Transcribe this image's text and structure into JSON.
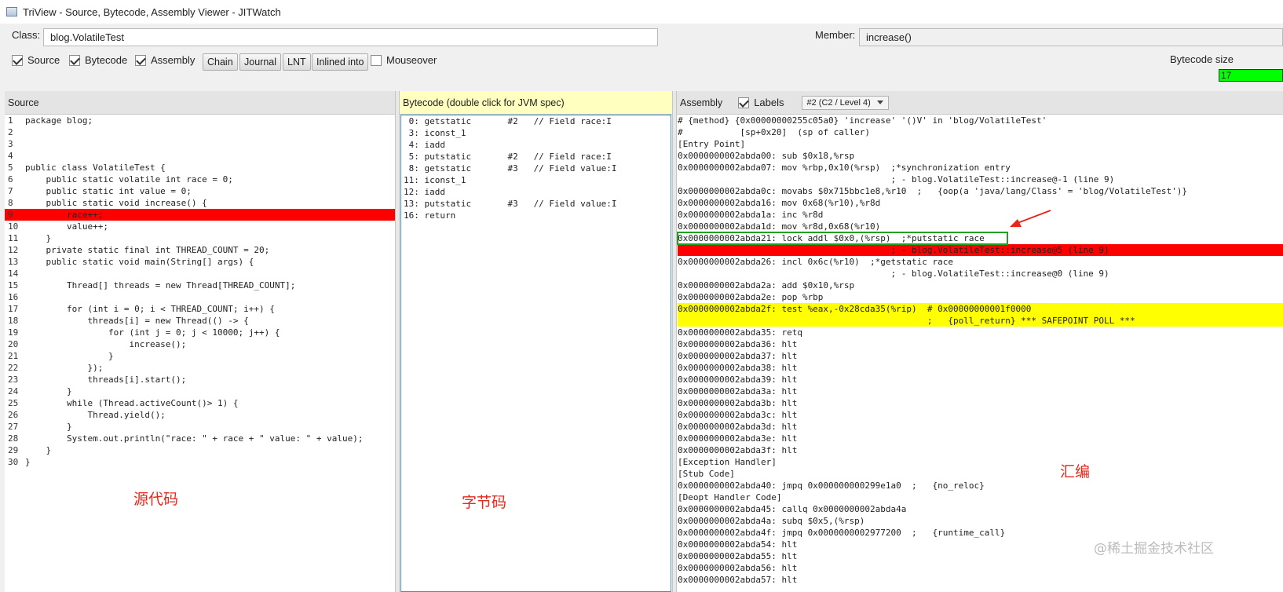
{
  "window": {
    "title": "TriView - Source, Bytecode, Assembly Viewer - JITWatch"
  },
  "toolbar": {
    "class_label": "Class:",
    "class_value": "blog.VolatileTest",
    "member_label": "Member:",
    "member_value": "increase()",
    "checkboxes": [
      {
        "label": "Source",
        "checked": true
      },
      {
        "label": "Bytecode",
        "checked": true
      },
      {
        "label": "Assembly",
        "checked": true
      }
    ],
    "buttons": [
      "Chain",
      "Journal",
      "LNT",
      "Inlined into"
    ],
    "mouseover": {
      "label": "Mouseover",
      "checked": false
    },
    "bytecode_size_label": "Bytecode size",
    "bytecode_size_value": "17",
    "bytecode_size_color": "#00ff00"
  },
  "source": {
    "header": "Source",
    "lines": [
      {
        "n": "1",
        "t": "package blog;"
      },
      {
        "n": "2",
        "t": ""
      },
      {
        "n": "3",
        "t": ""
      },
      {
        "n": "4",
        "t": ""
      },
      {
        "n": "5",
        "t": "public class VolatileTest {"
      },
      {
        "n": "6",
        "t": "    public static volatile int race = 0;"
      },
      {
        "n": "7",
        "t": "    public static int value = 0;"
      },
      {
        "n": "8",
        "t": "    public static void increase() {"
      },
      {
        "n": "9",
        "t": "        race++;",
        "hl": "red"
      },
      {
        "n": "10",
        "t": "        value++;"
      },
      {
        "n": "11",
        "t": "    }"
      },
      {
        "n": "12",
        "t": "    private static final int THREAD_COUNT = 20;"
      },
      {
        "n": "13",
        "t": "    public static void main(String[] args) {"
      },
      {
        "n": "14",
        "t": ""
      },
      {
        "n": "15",
        "t": "        Thread[] threads = new Thread[THREAD_COUNT];"
      },
      {
        "n": "16",
        "t": ""
      },
      {
        "n": "17",
        "t": "        for (int i = 0; i < THREAD_COUNT; i++) {"
      },
      {
        "n": "18",
        "t": "            threads[i] = new Thread(() -> {"
      },
      {
        "n": "19",
        "t": "                for (int j = 0; j < 10000; j++) {"
      },
      {
        "n": "20",
        "t": "                    increase();"
      },
      {
        "n": "21",
        "t": "                }"
      },
      {
        "n": "22",
        "t": "            });"
      },
      {
        "n": "23",
        "t": "            threads[i].start();"
      },
      {
        "n": "24",
        "t": "        }"
      },
      {
        "n": "25",
        "t": "        while (Thread.activeCount()> 1) {"
      },
      {
        "n": "26",
        "t": "            Thread.yield();"
      },
      {
        "n": "27",
        "t": "        }"
      },
      {
        "n": "28",
        "t": "        System.out.println(\"race: \" + race + \" value: \" + value);"
      },
      {
        "n": "29",
        "t": "    }"
      },
      {
        "n": "30",
        "t": "}"
      }
    ]
  },
  "bytecode": {
    "header": "Bytecode (double click for JVM spec)",
    "header_color": "#ffffc0",
    "lines": [
      " 0: getstatic       #2   // Field race:I",
      " 3: iconst_1",
      " 4: iadd",
      " 5: putstatic       #2   // Field race:I",
      " 8: getstatic       #3   // Field value:I",
      "11: iconst_1",
      "12: iadd",
      "13: putstatic       #3   // Field value:I",
      "16: return"
    ]
  },
  "assembly": {
    "header": "Assembly",
    "labels_checkbox": {
      "label": "Labels",
      "checked": true
    },
    "combo_value": "#2  (C2 / Level 4)",
    "lines": [
      {
        "t": "# {method} {0x00000000255c05a0} 'increase' '()V' in 'blog/VolatileTest'"
      },
      {
        "t": "#           [sp+0x20]  (sp of caller)"
      },
      {
        "t": "[Entry Point]"
      },
      {
        "t": "0x0000000002abda00: sub $0x18,%rsp"
      },
      {
        "t": "0x0000000002abda07: mov %rbp,0x10(%rsp)  ;*synchronization entry"
      },
      {
        "t": "                                         ; - blog.VolatileTest::increase@-1 (line 9)"
      },
      {
        "t": "0x0000000002abda0c: movabs $0x715bbc1e8,%r10  ;   {oop(a 'java/lang/Class' = 'blog/VolatileTest')}"
      },
      {
        "t": "0x0000000002abda16: mov 0x68(%r10),%r8d"
      },
      {
        "t": "0x0000000002abda1a: inc %r8d"
      },
      {
        "t": "0x0000000002abda1d: mov %r8d,0x68(%r10)"
      },
      {
        "t": "0x0000000002abda21: lock addl $0x0,(%rsp)  ;*putstatic race",
        "box": true
      },
      {
        "t": "                                         ; - blog.VolatileTest::increase@5 (line 9)",
        "hl": "red"
      },
      {
        "t": "0x0000000002abda26: incl 0x6c(%r10)  ;*getstatic race"
      },
      {
        "t": "                                         ; - blog.VolatileTest::increase@0 (line 9)"
      },
      {
        "t": "0x0000000002abda2a: add $0x10,%rsp"
      },
      {
        "t": "0x0000000002abda2e: pop %rbp"
      },
      {
        "t": "0x0000000002abda2f: test %eax,-0x28cda35(%rip)  # 0x00000000001f0000",
        "hl": "yellow"
      },
      {
        "t": "                                                ;   {poll_return} *** SAFEPOINT POLL ***",
        "hl": "yellow"
      },
      {
        "t": "0x0000000002abda35: retq"
      },
      {
        "t": "0x0000000002abda36: hlt"
      },
      {
        "t": "0x0000000002abda37: hlt"
      },
      {
        "t": "0x0000000002abda38: hlt"
      },
      {
        "t": "0x0000000002abda39: hlt"
      },
      {
        "t": "0x0000000002abda3a: hlt"
      },
      {
        "t": "0x0000000002abda3b: hlt"
      },
      {
        "t": "0x0000000002abda3c: hlt"
      },
      {
        "t": "0x0000000002abda3d: hlt"
      },
      {
        "t": "0x0000000002abda3e: hlt"
      },
      {
        "t": "0x0000000002abda3f: hlt"
      },
      {
        "t": "[Exception Handler]"
      },
      {
        "t": "[Stub Code]"
      },
      {
        "t": "0x0000000002abda40: jmpq 0x000000000299e1a0  ;   {no_reloc}"
      },
      {
        "t": "[Deopt Handler Code]"
      },
      {
        "t": "0x0000000002abda45: callq 0x0000000002abda4a"
      },
      {
        "t": "0x0000000002abda4a: subq $0x5,(%rsp)"
      },
      {
        "t": "0x0000000002abda4f: jmpq 0x0000000002977200  ;   {runtime_call}"
      },
      {
        "t": "0x0000000002abda54: hlt"
      },
      {
        "t": "0x0000000002abda55: hlt"
      },
      {
        "t": "0x0000000002abda56: hlt"
      },
      {
        "t": "0x0000000002abda57: hlt"
      }
    ]
  },
  "annotations": {
    "source_label": "源代码",
    "bytecode_label": "字节码",
    "assembly_label": "汇编",
    "watermark": "@稀土掘金技术社区",
    "color": "#e8261a"
  }
}
